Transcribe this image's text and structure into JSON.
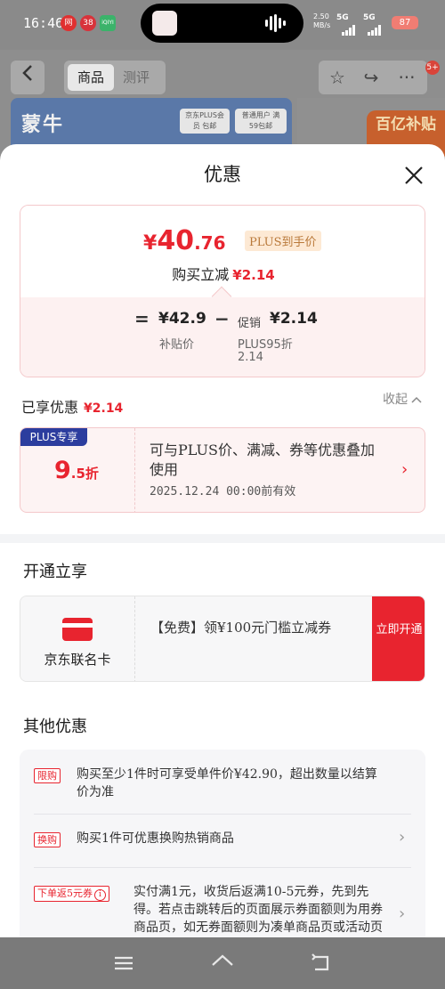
{
  "status_bar": {
    "time": "16:46",
    "app_icons": [
      "网",
      "38",
      "iQIYI"
    ],
    "speed": "2.50",
    "speed_unit": "MB/s",
    "network1": "5G",
    "network2": "5G",
    "battery": "87"
  },
  "background_page": {
    "tab_goods": "商品",
    "tab_reviews": "测评",
    "badge_count": "5+",
    "brand_logo": "蒙牛",
    "banner_tag1": "京东PLUS会员 包邮",
    "banner_tag2": "普通用户 满59包邮",
    "promo_text": "百亿补贴"
  },
  "sheet": {
    "title": "优惠",
    "price_card": {
      "currency": "¥",
      "price_int": "40",
      "price_dec": ".76",
      "plus_tag": "PLUS到手价",
      "reduce_label": "购买立减",
      "reduce_value": "¥2.14",
      "op_eq": "=",
      "subsidy_value": "¥42.9",
      "subsidy_label": "补贴价",
      "op_minus": "−",
      "promo_prefix": "促销",
      "promo_value": "¥2.14",
      "promo_detail_line1": "PLUS95折",
      "promo_detail_line2": "2.14"
    },
    "enjoyed": {
      "label": "已享优惠",
      "value": "¥2.14",
      "collapse": "收起"
    },
    "plus_offer": {
      "badge": "PLUS专享",
      "discount_int": "9",
      "discount_dec": ".5折",
      "description": "可与PLUS价、满减、券等优惠叠加使用",
      "expire": "2025.12.24 00:00前有效"
    },
    "open_section": {
      "title": "开通立享",
      "card_name": "京东联名卡",
      "card_desc": "【免费】领¥100元门槛立减券",
      "button": "立即开通"
    },
    "other_section": {
      "title": "其他优惠",
      "items": [
        {
          "tag": "限购",
          "text": "购买至少1件时可享受单件价¥42.90，超出数量以结算价为准"
        },
        {
          "tag": "换购",
          "text": "购买1件可优惠换购热销商品"
        },
        {
          "tag": "下单返5元券",
          "text": "实付满1元，收货后返满10-5元券，先到先得。若点击跳转后的页面展示券面额则为用券商品页，如无券面额则为凑单商品页或活动页"
        }
      ]
    }
  },
  "colors": {
    "accent_red": "#e8242f",
    "plus_blue": "#2c3d9e",
    "plus_gold": "#b9793a"
  }
}
